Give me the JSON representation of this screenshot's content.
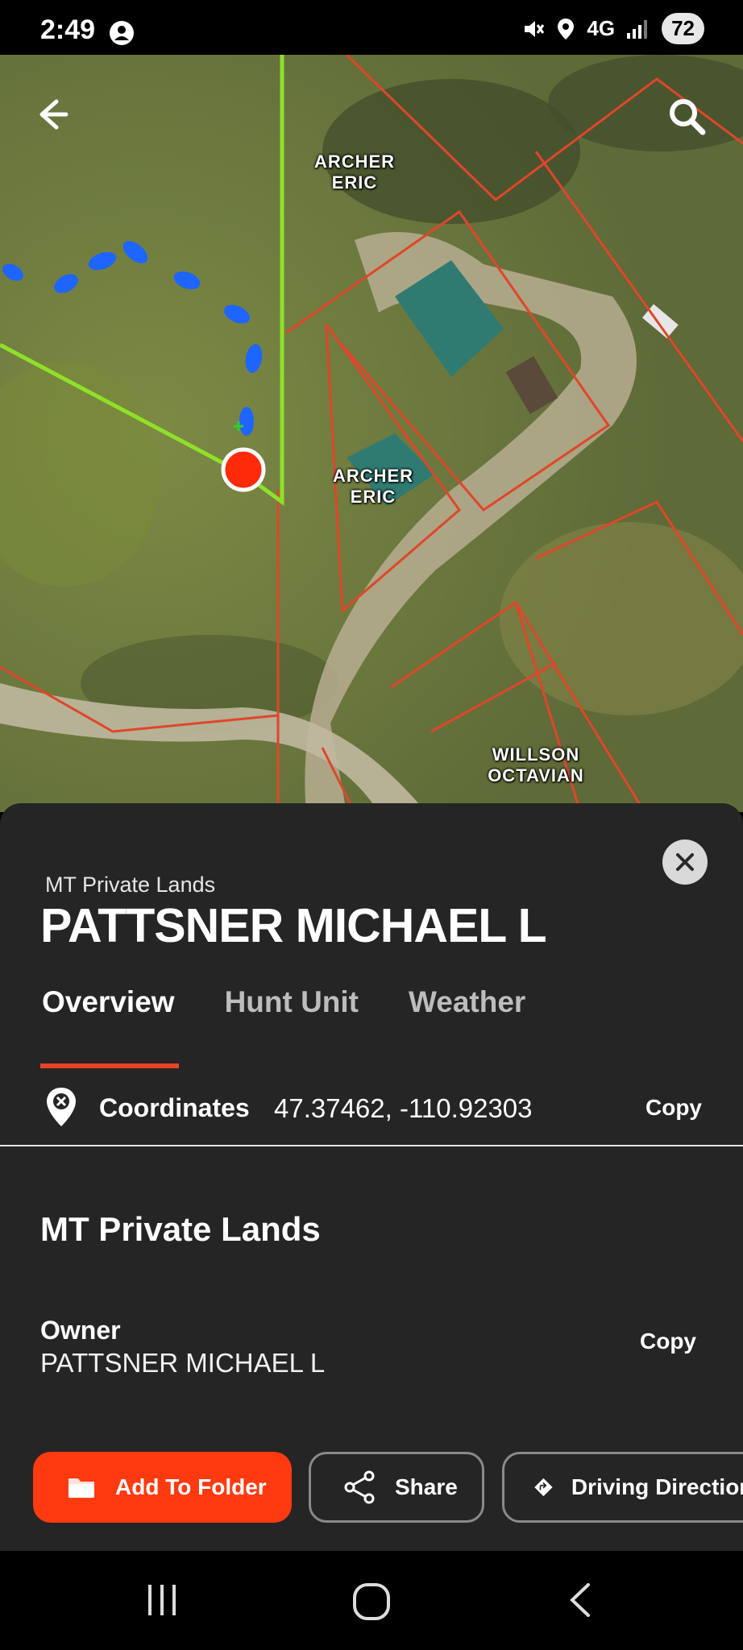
{
  "status_bar": {
    "time": "2:49",
    "network": "4G",
    "battery": "72",
    "icons": [
      "account-circle-icon",
      "mute-icon",
      "location-icon",
      "signal-icon"
    ]
  },
  "map": {
    "back_icon": "arrow-left-icon",
    "search_icon": "search-icon",
    "labels": [
      {
        "text_line1": "ARCHER",
        "text_line2": "ERIC"
      },
      {
        "text_line1": "ARCHER",
        "text_line2": "ERIC"
      },
      {
        "text_line1": "WILLSON",
        "text_line2": "OCTAVIAN"
      }
    ],
    "colors": {
      "parcel_line": "#e0462a",
      "route_line": "#8fe02a",
      "track_dots": "#1e64ff",
      "marker": "#ff2a0a"
    }
  },
  "sheet": {
    "layer_name": "MT Private Lands",
    "title": "PATTSNER MICHAEL L",
    "tabs": [
      {
        "label": "Overview",
        "active": true
      },
      {
        "label": "Hunt Unit",
        "active": false
      },
      {
        "label": "Weather",
        "active": false
      }
    ],
    "coordinates": {
      "label": "Coordinates",
      "value": "47.37462, -110.92303",
      "copy_label": "Copy"
    },
    "section_title": "MT Private Lands",
    "owner": {
      "label": "Owner",
      "value": "PATTSNER MICHAEL L",
      "copy_label": "Copy"
    },
    "actions": [
      {
        "label": "Add To Folder",
        "icon": "folder-icon"
      },
      {
        "label": "Share",
        "icon": "share-icon"
      },
      {
        "label": "Driving Directions",
        "icon": "directions-icon"
      }
    ],
    "accent_color": "#ff3a10"
  },
  "nav_bar": {
    "icons": [
      "recent-apps-icon",
      "home-icon",
      "back-icon"
    ]
  }
}
